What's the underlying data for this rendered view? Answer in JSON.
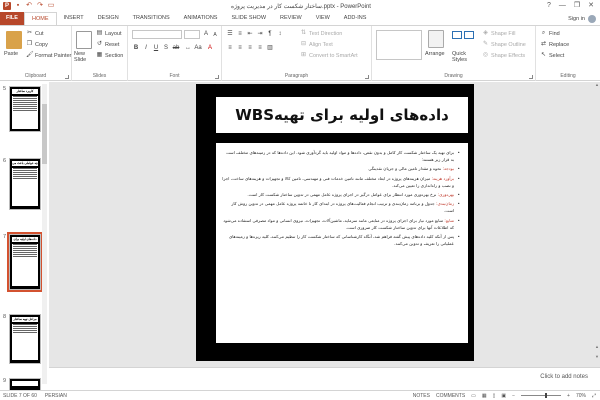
{
  "window": {
    "title": "ساختار شکست کار در مدیریت پروژه.pptx - PowerPoint",
    "help": "?",
    "minimize": "—",
    "restore": "❐",
    "close": "✕"
  },
  "tabs": {
    "file": "FILE",
    "items": [
      "HOME",
      "INSERT",
      "DESIGN",
      "TRANSITIONS",
      "ANIMATIONS",
      "SLIDE SHOW",
      "REVIEW",
      "VIEW",
      "ADD-INS"
    ],
    "user": "Sign in"
  },
  "ribbon": {
    "clipboard": {
      "label": "Clipboard",
      "paste": "Paste",
      "cut": "Cut",
      "copy": "Copy",
      "format_painter": "Format Painter"
    },
    "slides": {
      "label": "Slides",
      "new_slide": "New Slide",
      "layout": "Layout",
      "reset": "Reset",
      "section": "Section"
    },
    "font": {
      "label": "Font"
    },
    "paragraph": {
      "label": "Paragraph",
      "text_direction": "Text Direction",
      "align_text": "Align Text",
      "convert_smartart": "Convert to SmartArt"
    },
    "drawing": {
      "label": "Drawing",
      "arrange": "Arrange",
      "quick_styles": "Quick Styles",
      "shape_fill": "Shape Fill",
      "shape_outline": "Shape Outline",
      "shape_effects": "Shape Effects"
    },
    "editing": {
      "label": "Editing",
      "find": "Find",
      "replace": "Replace",
      "select": "Select"
    }
  },
  "thumbnails": [
    {
      "number": "5",
      "title": "کاربرد ساختار شکست کار"
    },
    {
      "number": "6",
      "title": "چه عواملی باعث می شود"
    },
    {
      "number": "7",
      "title": "داده‌های اولیه برای تهیه WBS"
    },
    {
      "number": "8",
      "title": "مراحل تهیه ساختار شکست کار"
    },
    {
      "number": "9",
      "title": ""
    }
  ],
  "slide": {
    "title": "داده‌های اولیه برای تهیهWBS",
    "bullets": [
      {
        "lead": "",
        "text": "برای تهیه یک ساختار شکست کار کامل و بدون نقص، داده‌ها و مواد اولیه باید گردآوری شود. این داده‌ها که در زمینه‌های مختلف است به قرار زیر هستند:"
      },
      {
        "lead": "بودجه:",
        "text": " نحوه و مقدار تامین مالی و جریان نقدینگی"
      },
      {
        "lead": "برآورد هزینه:",
        "text": " میزان هزینه‌های پروژه در ابعاد مختلف مانند تامین خدمات فنی و مهندسی، تامین کالا و تجهیزات و هزینه‌های ساخت، اجرا و نصب و راه‌اندازی را تعیین می‌کند."
      },
      {
        "lead": "بهره‌وری:",
        "text": " نرخ بهره‌وری مورد انتظار برای عوامل درگیر در اجرای پروژه عامل مهمی در تدوین ساختار شکست کار است."
      },
      {
        "lead": "زمان‌بندی:",
        "text": " جدول و برنامه زمان‌بندی و ترتیب انجام فعالیت‌های پروژه در ابتدای کار تا خاتمه پروژه عامل مهمی در تدوین روش کار است."
      },
      {
        "lead": "منابع:",
        "text": " منابع مورد نیاز برای اجرای پروژه در منابعی مانند سرمایه، ماشین‌آلات، تجهیزات، نیروی انسانی و مواد مصرفی استفاده می‌شود که اطلاعات آنها برای تدوین ساختار شکست کار ضروری است."
      },
      {
        "lead": "",
        "text": "پس از آنکه کلیه داده‌های پیش گفته فراهم شد، آنگاه کارشناسانی که ساختار شکست کار را تنظیم می‌کنند، کلیه ریزه‌ها و زمینه‌های عملیاتی را تعریف و تدوین می‌کنند."
      }
    ]
  },
  "notes": {
    "placeholder": "Click to add notes"
  },
  "status": {
    "slide_indicator": "SLIDE 7 OF 60",
    "language": "PERSIAN",
    "notes": "NOTES",
    "comments": "COMMENTS",
    "zoom": "70%"
  },
  "colors": {
    "accent": "#b7472a",
    "selection": "#d35230",
    "slide_background": "#000000",
    "bullet_lead": "#c0392b"
  }
}
